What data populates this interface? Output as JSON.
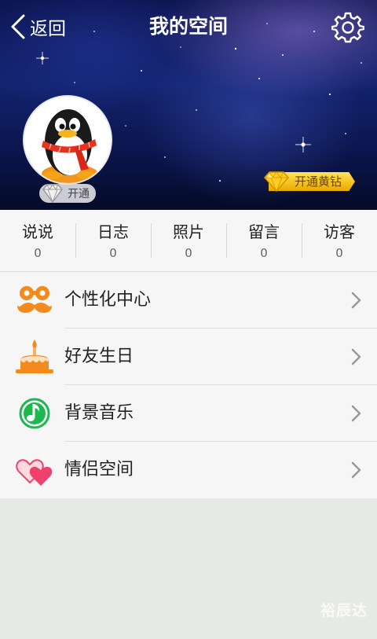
{
  "header": {
    "back_label": "返回",
    "title": "我的空间",
    "open_badge_label": "开通",
    "yellow_diamond_label": "开通黄钻"
  },
  "stats": [
    {
      "label": "说说",
      "value": "0"
    },
    {
      "label": "日志",
      "value": "0"
    },
    {
      "label": "照片",
      "value": "0"
    },
    {
      "label": "留言",
      "value": "0"
    },
    {
      "label": "访客",
      "value": "0"
    }
  ],
  "menu": [
    {
      "label": "个性化中心",
      "icon": "mustache-icon"
    },
    {
      "label": "好友生日",
      "icon": "birthday-cake-icon"
    },
    {
      "label": "背景音乐",
      "icon": "music-note-icon"
    },
    {
      "label": "情侣空间",
      "icon": "hearts-icon"
    }
  ],
  "watermark": "裕辰达",
  "colors": {
    "header_bg": "#0c1550",
    "menu_orange": "#f28a1c",
    "music_green": "#1bb94d",
    "heart_pink": "#f0416d",
    "gold": "#f4c01a"
  }
}
